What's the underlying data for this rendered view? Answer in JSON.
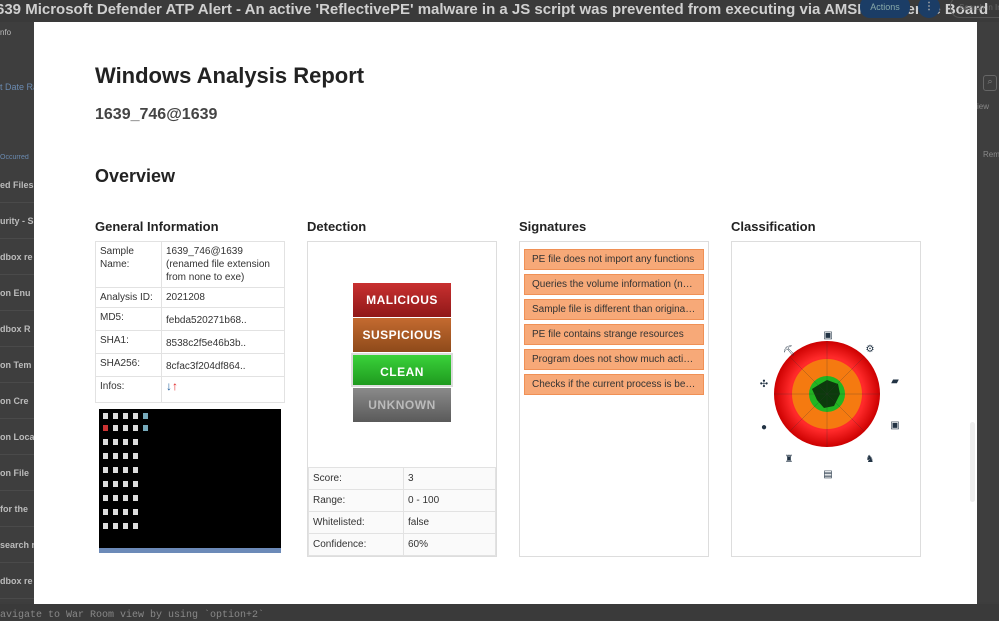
{
  "app": {
    "title": "639  Microsoft Defender ATP Alert - An active 'ReflectivePE' malware in a JS script was prevented from executing via AMSI - Evidence Board",
    "actions_label": "Actions",
    "more_label": "⋮",
    "search_placeholder": "Search in In",
    "footer_hint": "avigate to War Room view by using `option+2`",
    "sidebar": [
      "nfo",
      "t Date Ra",
      "Occurred",
      "ed Files",
      "urity - S",
      "dbox re",
      "on Enu",
      "dbox R",
      "on Tem",
      "on Cre",
      "on Loca",
      "on File",
      "for the",
      "search r",
      "dbox re"
    ],
    "right_side": [
      "iew",
      "Rem"
    ]
  },
  "report": {
    "title": "Windows Analysis Report",
    "sample_id": "1639_746@1639",
    "overview": "Overview",
    "general": {
      "heading": "General Information",
      "rows": [
        {
          "k": "Sample Name:",
          "v": "1639_746@1639 (renamed file extension from none to exe)"
        },
        {
          "k": "Analysis ID:",
          "v": "2021208"
        },
        {
          "k": "MD5:",
          "v": "febda520271b68.."
        },
        {
          "k": "SHA1:",
          "v": "8538c2f5e46b3b.."
        },
        {
          "k": "SHA256:",
          "v": "8cfac3f204df864.."
        },
        {
          "k": "Infos:",
          "v": ""
        }
      ]
    },
    "detection": {
      "heading": "Detection",
      "levels": [
        "MALICIOUS",
        "SUSPICIOUS",
        "CLEAN",
        "UNKNOWN"
      ],
      "selected": "CLEAN",
      "rows": [
        {
          "k": "Score:",
          "v": "3"
        },
        {
          "k": "Range:",
          "v": "0 - 100"
        },
        {
          "k": "Whitelisted:",
          "v": "false"
        },
        {
          "k": "Confidence:",
          "v": "60%"
        }
      ]
    },
    "signatures": {
      "heading": "Signatures",
      "items": [
        "PE file does not import any functions",
        "Queries the volume information (name, serial number etc) of a device",
        "Sample file is different than original file name",
        "PE file contains strange resources",
        "Program does not show much activity (idle)",
        "Checks if the current process is being debugged"
      ]
    },
    "classification": {
      "heading": "Classification"
    }
  },
  "colors": {
    "malicious": "#b02020",
    "suspicious": "#b35a20",
    "clean": "#2eb82e",
    "unknown": "#777777",
    "signature": "#f7a978"
  }
}
